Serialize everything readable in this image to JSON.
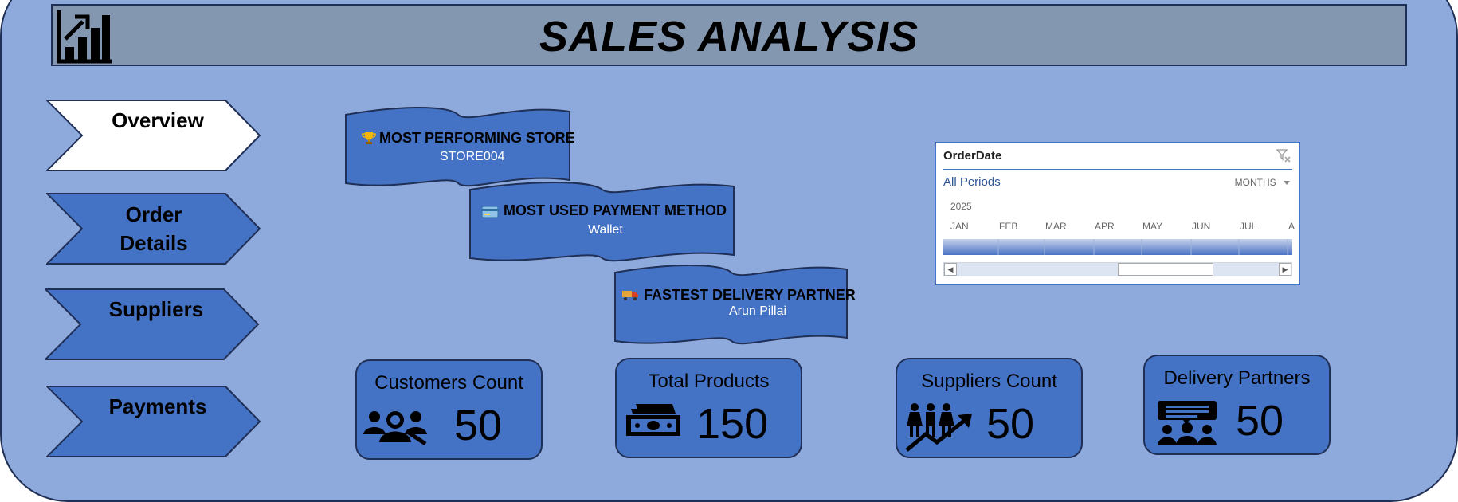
{
  "header": {
    "title": "SALES ANALYSIS",
    "icon": "bar-chart-growth-icon"
  },
  "nav": {
    "items": [
      {
        "label": "Overview",
        "active": true
      },
      {
        "label": "Order Details",
        "active": false
      },
      {
        "label": "Suppliers",
        "active": false
      },
      {
        "label": "Payments",
        "active": false
      }
    ]
  },
  "highlights": [
    {
      "icon": "trophy-icon",
      "title": "MOST PERFORMING STORE",
      "value": "STORE004"
    },
    {
      "icon": "credit-card-icon",
      "title": "MOST USED PAYMENT METHOD",
      "value": "Wallet"
    },
    {
      "icon": "delivery-truck-icon",
      "title": "FASTEST DELIVERY PARTNER",
      "value": "Arun Pillai"
    }
  ],
  "timeline": {
    "header": "OrderDate",
    "periods": "All Periods",
    "level": "MONTHS",
    "year": "2025",
    "months": [
      "JAN",
      "FEB",
      "MAR",
      "APR",
      "MAY",
      "JUN",
      "JUL",
      "A"
    ]
  },
  "kpis": [
    {
      "title": "Customers Count",
      "value": "50",
      "icon": "customers-group-icon"
    },
    {
      "title": "Total Products",
      "value": "150",
      "icon": "money-stack-icon"
    },
    {
      "title": "Suppliers Count",
      "value": "50",
      "icon": "people-growth-icon"
    },
    {
      "title": "Delivery Partners",
      "value": "50",
      "icon": "team-chat-icon"
    }
  ],
  "colors": {
    "background": "#8eaadc",
    "title_bar": "#8497b0",
    "accent": "#4472c4",
    "border": "#1f2f55"
  }
}
